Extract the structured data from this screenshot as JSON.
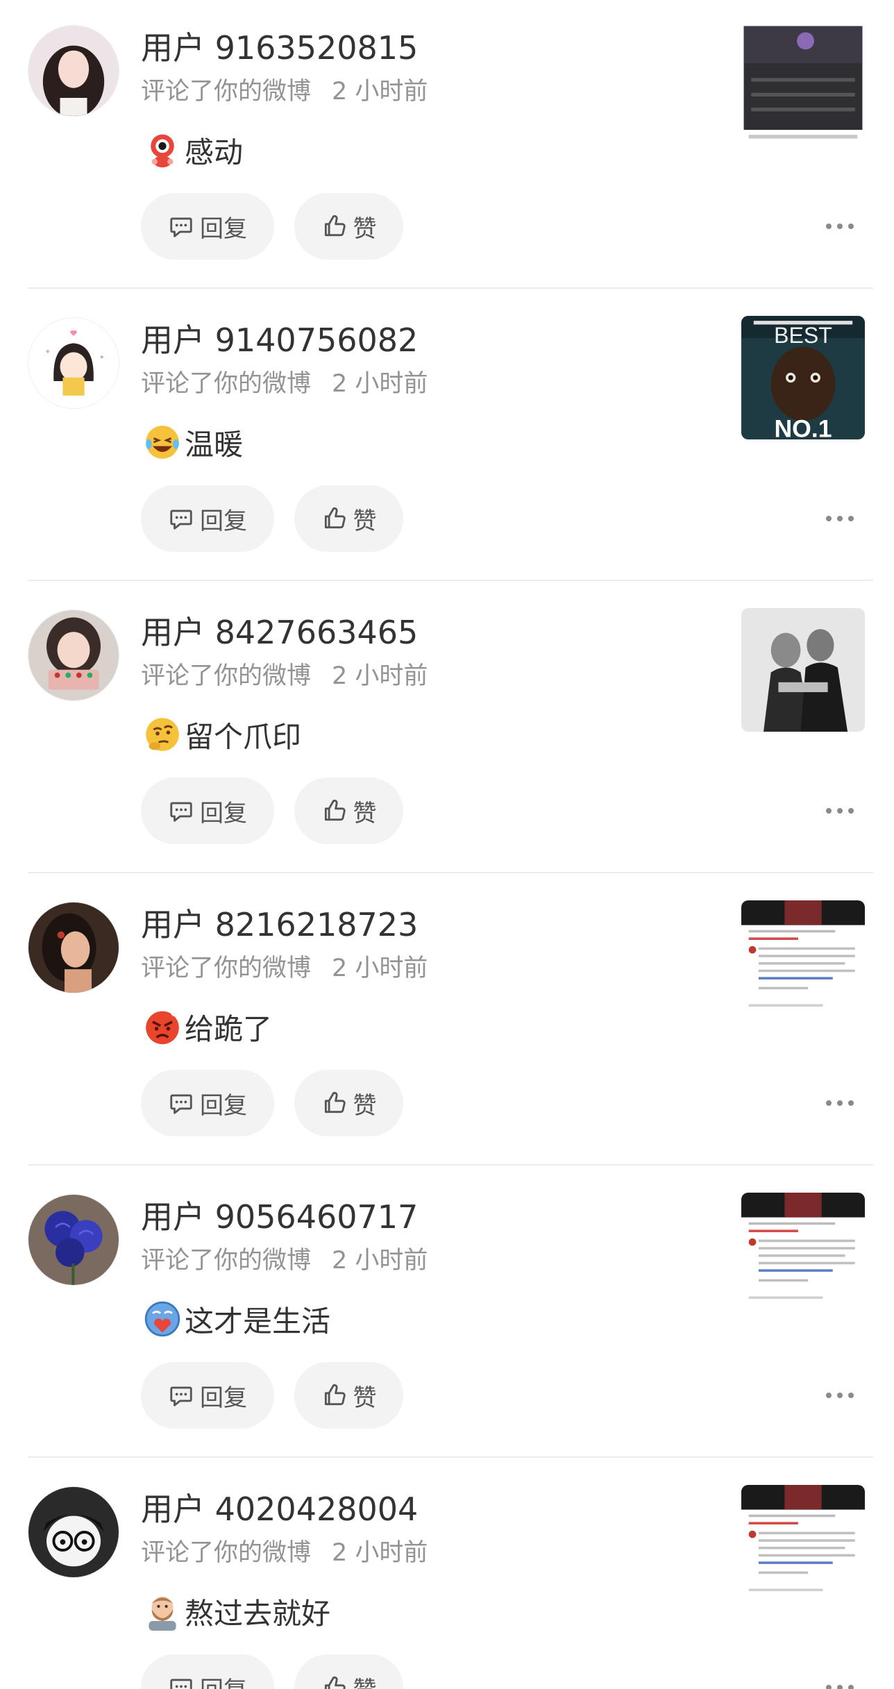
{
  "colors": {
    "text_primary": "#333333",
    "text_secondary": "#939393",
    "button_bg": "#f3f3f3",
    "divider": "#ececec"
  },
  "buttons": {
    "reply_label": "回复",
    "like_label": "赞"
  },
  "notifications": [
    {
      "username": "用户 9163520815",
      "action": "评论了你的微博",
      "time": "2 小时前",
      "emoji": "eye-mascot-emoji",
      "comment": "感动",
      "avatar": "girl-portrait-avatar",
      "thumbnail": "dark-venue-photo"
    },
    {
      "username": "用户 9140756082",
      "action": "评论了你的微博",
      "time": "2 小时前",
      "emoji": "laughing-tears-emoji",
      "comment": "温暖",
      "avatar": "cartoon-girl-avatar",
      "thumbnail": "movie-poster-photo"
    },
    {
      "username": "用户 8427663465",
      "action": "评论了你的微博",
      "time": "2 小时前",
      "emoji": "thinking-emoji",
      "comment": "留个爪印",
      "avatar": "girl-with-cake-avatar",
      "thumbnail": "black-white-couple-photo"
    },
    {
      "username": "用户 8216218723",
      "action": "评论了你的微博",
      "time": "2 小时前",
      "emoji": "angry-emoji",
      "comment": "给跪了",
      "avatar": "woman-portrait-avatar",
      "thumbnail": "post-screenshot"
    },
    {
      "username": "用户 9056460717",
      "action": "评论了你的微博",
      "time": "2 小时前",
      "emoji": "blue-heart-face-emoji",
      "comment": "这才是生活",
      "avatar": "blue-rose-avatar",
      "thumbnail": "post-screenshot"
    },
    {
      "username": "用户 4020428004",
      "action": "评论了你的微博",
      "time": "2 小时前",
      "emoji": "bearded-man-emoji",
      "comment": "熬过去就好",
      "avatar": "cartoon-glasses-avatar",
      "thumbnail": "post-screenshot"
    }
  ]
}
